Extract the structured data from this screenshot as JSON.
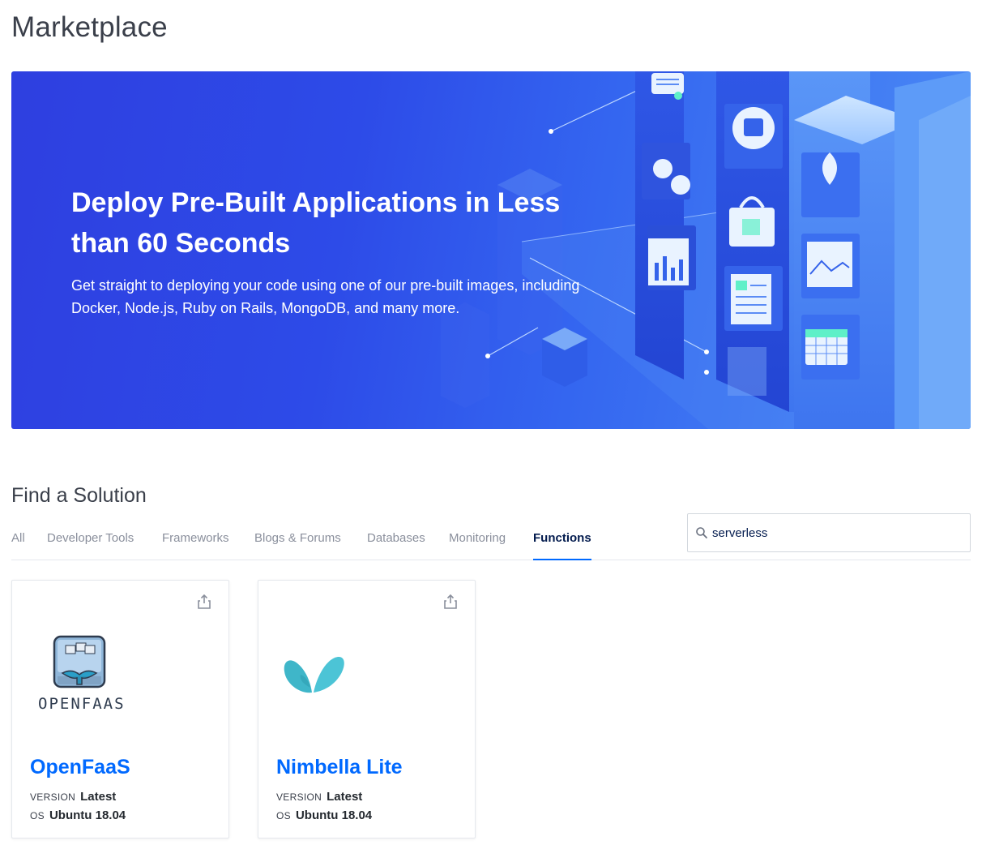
{
  "page": {
    "title": "Marketplace"
  },
  "hero": {
    "title": "Deploy Pre-Built Applications in Less than 60 Seconds",
    "subtitle": "Get straight to deploying your code using one of our pre-built images, including Docker, Node.js, Ruby on Rails, MongoDB, and many more.",
    "colors": {
      "start": "#2e3fe0",
      "end": "#4c8cf5"
    }
  },
  "solutions": {
    "title": "Find a Solution",
    "tabs": [
      {
        "label": "All"
      },
      {
        "label": "Developer Tools"
      },
      {
        "label": "Frameworks"
      },
      {
        "label": "Blogs & Forums"
      },
      {
        "label": "Databases"
      },
      {
        "label": "Monitoring"
      },
      {
        "label": "Functions",
        "active": true
      }
    ],
    "search": {
      "value": "serverless",
      "icon": "search-icon"
    }
  },
  "cards": [
    {
      "name": "OpenFaaS",
      "logo_text": "OPENFAAS",
      "version_label": "VERSION",
      "version": "Latest",
      "os_label": "OS",
      "os": "Ubuntu 18.04",
      "icon": "share-icon"
    },
    {
      "name": "Nimbella Lite",
      "version_label": "VERSION",
      "version": "Latest",
      "os_label": "OS",
      "os": "Ubuntu 18.04",
      "icon": "share-icon"
    }
  ],
  "colors": {
    "accent": "#0069ff",
    "text": "#031b4e",
    "muted": "#8a8f9c"
  }
}
